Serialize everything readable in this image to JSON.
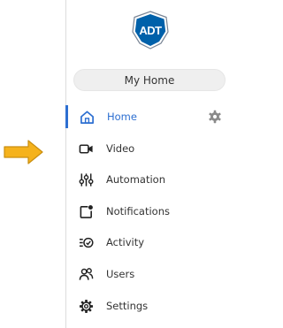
{
  "brand": {
    "logo_text": "ADT",
    "color": "#0061aa"
  },
  "home_selector": {
    "label": "My Home"
  },
  "accent": "#2d6fd1",
  "pointer_color": "#f5b21c",
  "nav": {
    "items": [
      {
        "label": "Home",
        "icon": "home-icon",
        "active": true
      },
      {
        "label": "Video",
        "icon": "video-camera-icon"
      },
      {
        "label": "Automation",
        "icon": "sliders-icon"
      },
      {
        "label": "Notifications",
        "icon": "notification-icon"
      },
      {
        "label": "Activity",
        "icon": "activity-icon"
      },
      {
        "label": "Users",
        "icon": "users-icon"
      },
      {
        "label": "Settings",
        "icon": "gear-icon"
      }
    ]
  }
}
